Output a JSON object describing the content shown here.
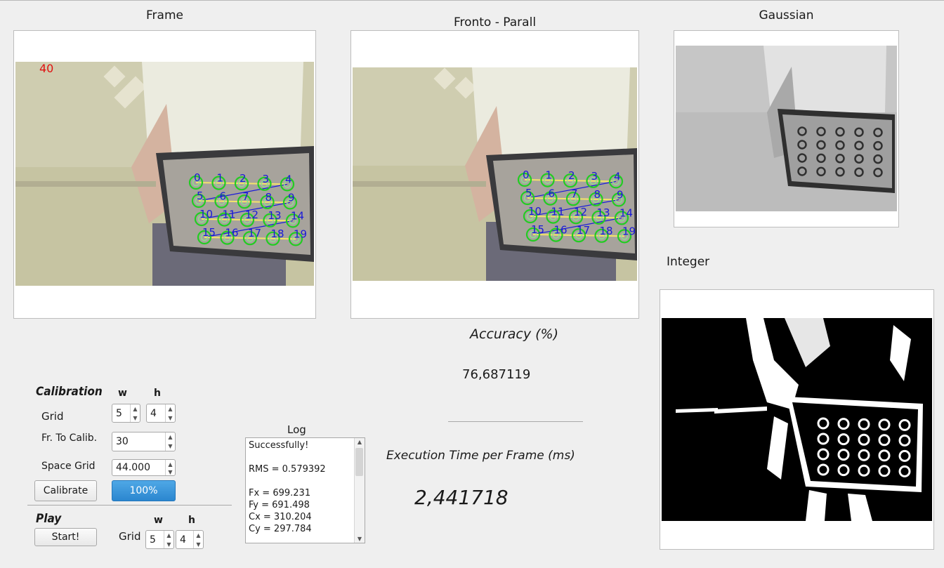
{
  "panels": {
    "frame_title": "Frame",
    "fronto_title": "Fronto - Parall",
    "gaussian_title": "Gaussian",
    "integer_title": "Integer",
    "frame_counter": "40"
  },
  "grid_point_labels": [
    "0",
    "1",
    "2",
    "3",
    "4",
    "5",
    "6",
    "7",
    "8",
    "9",
    "10",
    "11",
    "12",
    "13",
    "14",
    "15",
    "16",
    "17",
    "18",
    "19"
  ],
  "metrics": {
    "accuracy_label": "Accuracy (%)",
    "accuracy_value": "76,687119",
    "exec_label": "Execution Time per Frame (ms)",
    "exec_value": "2,441718"
  },
  "calibration": {
    "title": "Calibration",
    "w_header": "w",
    "h_header": "h",
    "grid_label": "Grid",
    "grid_w": "5",
    "grid_h": "4",
    "frames_label": "Fr. To Calib.",
    "frames_value": "30",
    "space_label": "Space Grid",
    "space_value": "44.000",
    "calibrate_button": "Calibrate",
    "progress_text": "100%",
    "progress_value": 100
  },
  "play": {
    "title": "Play",
    "w_header": "w",
    "h_header": "h",
    "start_button": "Start!",
    "grid_label": "Grid",
    "grid_w": "5",
    "grid_h": "4"
  },
  "log": {
    "title": "Log",
    "lines": [
      "Successfully!",
      "",
      "RMS = 0.579392",
      "",
      "Fx = 699.231",
      "Fy = 691.498",
      "Cx = 310.204",
      "Cy = 297.784"
    ]
  },
  "colors": {
    "progress": "#2b86cf",
    "grid_circle": "#22cc22",
    "grid_label": "#1a1ad8",
    "frame_counter": "#e01010"
  }
}
